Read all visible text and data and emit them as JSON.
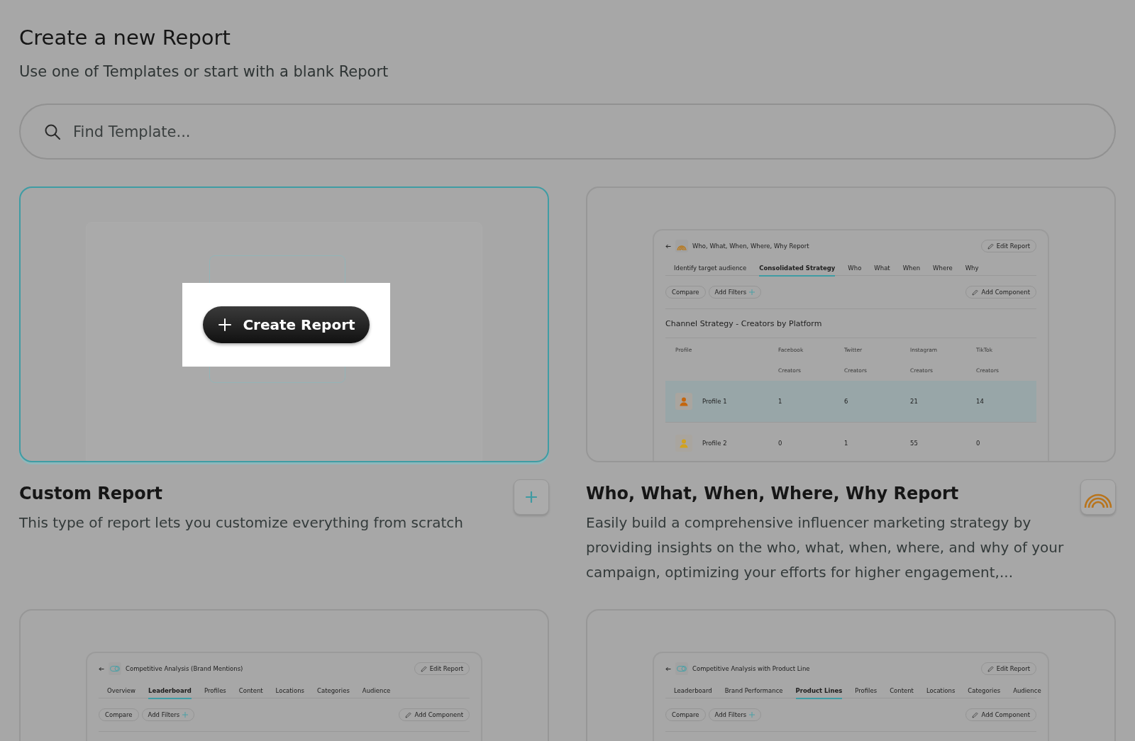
{
  "header": {
    "title": "Create a new Report",
    "subtitle": "Use one of Templates or start with a blank Report"
  },
  "search": {
    "placeholder": "Find Template..."
  },
  "templates": [
    {
      "kind": "blank",
      "selected": true,
      "title": "Custom Report",
      "description": "This type of report lets you customize everything from scratch",
      "preview": {
        "button_label": "Create Report"
      }
    },
    {
      "kind": "report",
      "selected": false,
      "title": "Who, What, When, Where, Why Report",
      "description": "Easily build a comprehensive influencer marketing strategy by providing insights on the who, what, when, where, and why of your campaign, optimizing your efforts for higher engagement,...",
      "preview": {
        "title": "Who, What, When, Where, Why Report",
        "edit": "Edit Report",
        "tabs": [
          {
            "label": "Identify target audience",
            "selected": false
          },
          {
            "label": "Consolidated Strategy",
            "selected": true
          },
          {
            "label": "Who",
            "selected": false
          },
          {
            "label": "What",
            "selected": false
          },
          {
            "label": "When",
            "selected": false
          },
          {
            "label": "Where",
            "selected": false
          },
          {
            "label": "Why",
            "selected": false
          }
        ],
        "compare": "Compare",
        "add_filters": "Add Filters",
        "add_component": "Add Component",
        "table": {
          "title": "Channel Strategy - Creators by Platform",
          "columns": [
            {
              "name": "Profile"
            },
            {
              "name": "Facebook",
              "sub": "Creators"
            },
            {
              "name": "Twitter",
              "sub": "Creators"
            },
            {
              "name": "Instagram",
              "sub": "Creators"
            },
            {
              "name": "TikTok",
              "sub": "Creators"
            }
          ],
          "rows": [
            {
              "selected": true,
              "color": "#c4660e",
              "cells": [
                "Profile 1",
                "1",
                "6",
                "21",
                "14"
              ]
            },
            {
              "selected": false,
              "color": "#d2a21e",
              "cells": [
                "Profile 2",
                "0",
                "1",
                "55",
                "0"
              ]
            }
          ]
        }
      }
    },
    {
      "kind": "report",
      "selected": false,
      "preview": {
        "title": "Competitive Analysis (Brand Mentions)",
        "edit": "Edit Report",
        "tabs": [
          {
            "label": "Overview",
            "selected": false
          },
          {
            "label": "Leaderboard",
            "selected": true
          },
          {
            "label": "Profiles",
            "selected": false
          },
          {
            "label": "Content",
            "selected": false
          },
          {
            "label": "Locations",
            "selected": false
          },
          {
            "label": "Categories",
            "selected": false
          },
          {
            "label": "Audience",
            "selected": false
          }
        ],
        "compare": "Compare",
        "add_filters": "Add Filters",
        "add_component": "Add Component"
      }
    },
    {
      "kind": "report",
      "selected": false,
      "preview": {
        "title": "Competitive Analysis with Product Line",
        "edit": "Edit Report",
        "tabs": [
          {
            "label": "Leaderboard",
            "selected": false
          },
          {
            "label": "Brand Performance",
            "selected": false
          },
          {
            "label": "Product Lines",
            "selected": true
          },
          {
            "label": "Profiles",
            "selected": false
          },
          {
            "label": "Content",
            "selected": false
          },
          {
            "label": "Locations",
            "selected": false
          },
          {
            "label": "Categories",
            "selected": false
          },
          {
            "label": "Audience",
            "selected": false
          }
        ],
        "compare": "Compare",
        "add_filters": "Add Filters",
        "add_component": "Add Component"
      }
    }
  ]
}
